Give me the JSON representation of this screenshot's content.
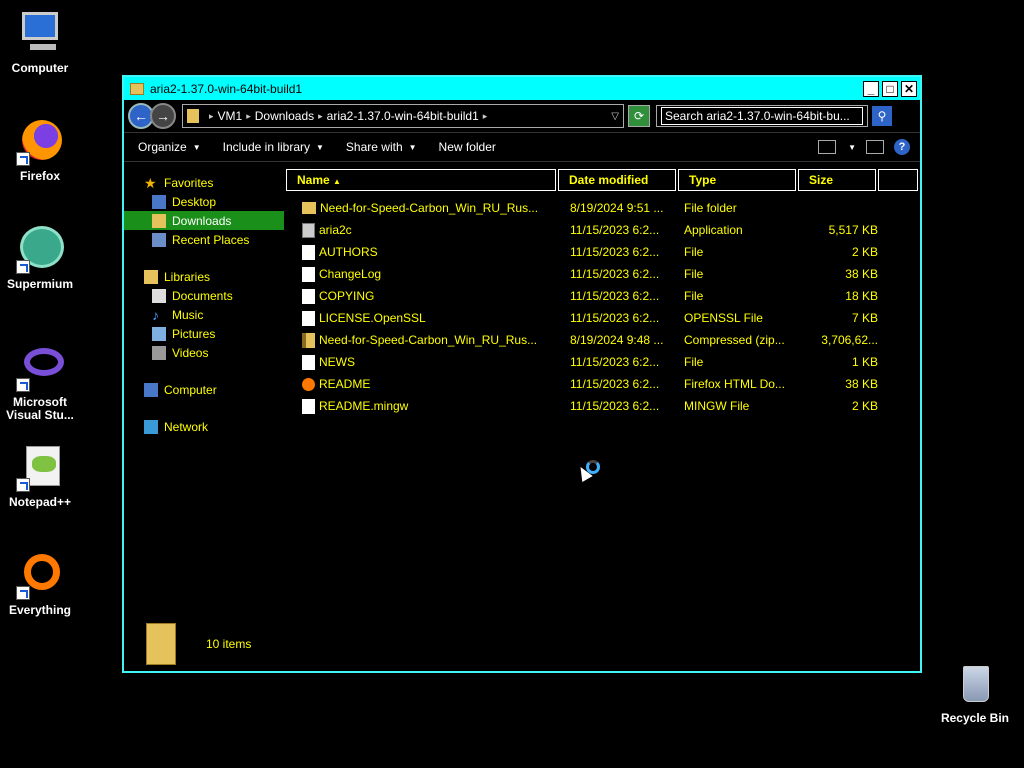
{
  "desktop": {
    "icons": [
      {
        "label": "Computer",
        "icon": "computer-icon"
      },
      {
        "label": "Firefox",
        "icon": "firefox-icon"
      },
      {
        "label": "Supermium",
        "icon": "supermium-icon"
      },
      {
        "label": "Microsoft Visual Stu...",
        "icon": "visual-studio-icon"
      },
      {
        "label": "Notepad++",
        "icon": "notepadpp-icon"
      },
      {
        "label": "Everything",
        "icon": "everything-icon"
      },
      {
        "label": "Recycle Bin",
        "icon": "recycle-bin-icon"
      }
    ]
  },
  "window": {
    "title": "aria2-1.37.0-win-64bit-build1",
    "colors": {
      "titlebar": "#00ffff",
      "border": "#3ff4f4",
      "text": "#ffff00",
      "selected": "#1a8f1a"
    },
    "breadcrumb": [
      "VM1",
      "Downloads",
      "aria2-1.37.0-win-64bit-build1"
    ],
    "search": {
      "placeholder": "Search aria2-1.37.0-win-64bit-bu..."
    },
    "toolbar": {
      "organize": "Organize",
      "include_in_library": "Include in library",
      "share_with": "Share with",
      "new_folder": "New folder"
    },
    "nav": {
      "favorites": "Favorites",
      "desktop": "Desktop",
      "downloads": "Downloads",
      "recent_places": "Recent Places",
      "libraries": "Libraries",
      "documents": "Documents",
      "music": "Music",
      "pictures": "Pictures",
      "videos": "Videos",
      "computer": "Computer",
      "network": "Network"
    },
    "columns": {
      "name": "Name",
      "date": "Date modified",
      "type": "Type",
      "size": "Size"
    },
    "files": [
      {
        "name": "Need-for-Speed-Carbon_Win_RU_Rus...",
        "date": "8/19/2024 9:51 ...",
        "type": "File folder",
        "size": "",
        "icon": "folder"
      },
      {
        "name": "aria2c",
        "date": "11/15/2023 6:2...",
        "type": "Application",
        "size": "5,517 KB",
        "icon": "app"
      },
      {
        "name": "AUTHORS",
        "date": "11/15/2023 6:2...",
        "type": "File",
        "size": "2 KB",
        "icon": "file"
      },
      {
        "name": "ChangeLog",
        "date": "11/15/2023 6:2...",
        "type": "File",
        "size": "38 KB",
        "icon": "file"
      },
      {
        "name": "COPYING",
        "date": "11/15/2023 6:2...",
        "type": "File",
        "size": "18 KB",
        "icon": "file"
      },
      {
        "name": "LICENSE.OpenSSL",
        "date": "11/15/2023 6:2...",
        "type": "OPENSSL File",
        "size": "7 KB",
        "icon": "file"
      },
      {
        "name": "Need-for-Speed-Carbon_Win_RU_Rus...",
        "date": "8/19/2024 9:48 ...",
        "type": "Compressed (zip...",
        "size": "3,706,62...",
        "icon": "zip"
      },
      {
        "name": "NEWS",
        "date": "11/15/2023 6:2...",
        "type": "File",
        "size": "1 KB",
        "icon": "file"
      },
      {
        "name": "README",
        "date": "11/15/2023 6:2...",
        "type": "Firefox HTML Do...",
        "size": "38 KB",
        "icon": "ff"
      },
      {
        "name": "README.mingw",
        "date": "11/15/2023 6:2...",
        "type": "MINGW File",
        "size": "2 KB",
        "icon": "file"
      }
    ],
    "status": {
      "count": "10 items"
    }
  }
}
